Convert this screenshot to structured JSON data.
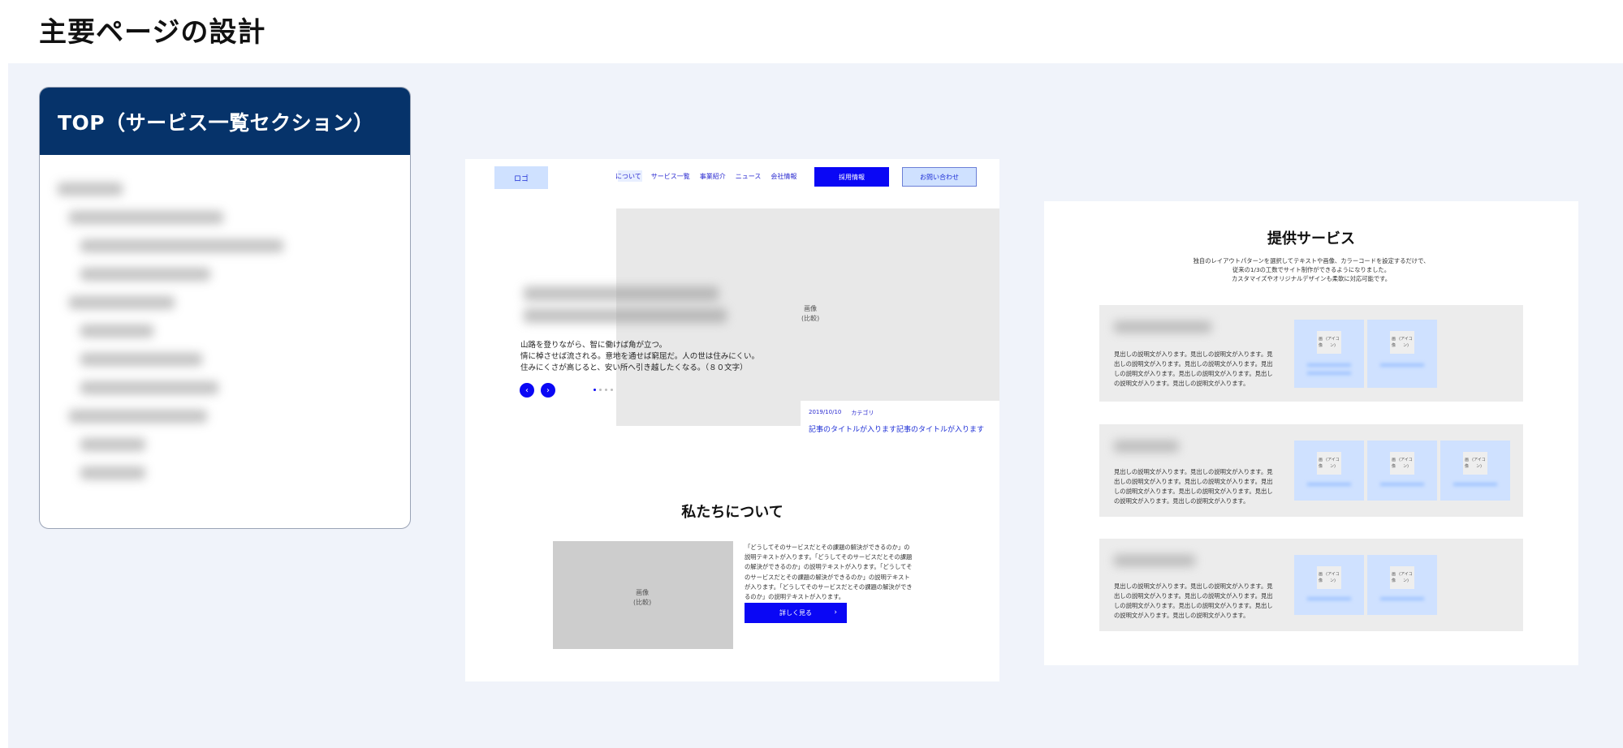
{
  "page": {
    "heading": "主要ページの設計"
  },
  "nav_card": {
    "title": "TOP（サービス一覧セクション）",
    "items": [
      {
        "depth": 0,
        "width": 80
      },
      {
        "depth": 1,
        "width": 190
      },
      {
        "depth": 2,
        "width": 250
      },
      {
        "depth": 2,
        "width": 160
      },
      {
        "depth": 1,
        "width": 130
      },
      {
        "depth": 2,
        "width": 90
      },
      {
        "depth": 2,
        "width": 150
      },
      {
        "depth": 2,
        "width": 170
      },
      {
        "depth": 1,
        "width": 170
      },
      {
        "depth": 2,
        "width": 80
      },
      {
        "depth": 2,
        "width": 80
      }
    ]
  },
  "wf1": {
    "logo": "ロゴ",
    "nav_links": [
      "について",
      "サービス一覧",
      "事業紹介",
      "ニュース",
      "会社情報"
    ],
    "recruit_btn": "採用情報",
    "contact_btn": "お問い合わせ",
    "hero_image_label": "画像",
    "hero_image_sub": "(比較)",
    "hero_copy_1": "山路を登りながら、智に働けば角が立つ。",
    "hero_copy_2": "情に棹させば流される。意地を通せば窮屈だ。人の世は住みにくい。",
    "hero_copy_3": "住みにくさが高じると、安い所へ引き越したくなる。（８０文字）",
    "prev_arrow": "‹",
    "next_arrow": "›",
    "news_date": "2019/10/10",
    "news_category": "カテゴリ",
    "news_title": "記事のタイトルが入ります記事のタイトルが入ります",
    "about_heading": "私たちについて",
    "about_image_label": "画像",
    "about_image_sub": "(比較)",
    "about_text": "「どうしてそのサービスだとその課題の解決ができるのか」の説明テキストが入ります。「どうしてそのサービスだとその課題の解決ができるのか」の説明テキストが入ります。「どうしてそのサービスだとその課題の解決ができるのか」の説明テキストが入ります。「どうしてそのサービスだとその課題の解決ができるのか」の説明テキストが入ります。",
    "detail_btn": "詳しく見る",
    "detail_chev": "›"
  },
  "wf2": {
    "heading": "提供サービス",
    "desc_1": "独自のレイアウトパターンを選択してテキストや画像、カラーコードを設定するだけで、",
    "desc_2": "従来の1/3の工数でサイト制作ができるようになりました。",
    "desc_3": "カスタマイズやオリジナルデザインも柔軟に対応可能です。",
    "block_text": "見出しの説明文が入ります。見出しの説明文が入ります。見出しの説明文が入ります。見出しの説明文が入ります。見出しの説明文が入ります。見出しの説明文が入ります。見出しの説明文が入ります。見出しの説明文が入ります。",
    "thumb_label": "画像",
    "thumb_sub": "(アイコン)"
  }
}
